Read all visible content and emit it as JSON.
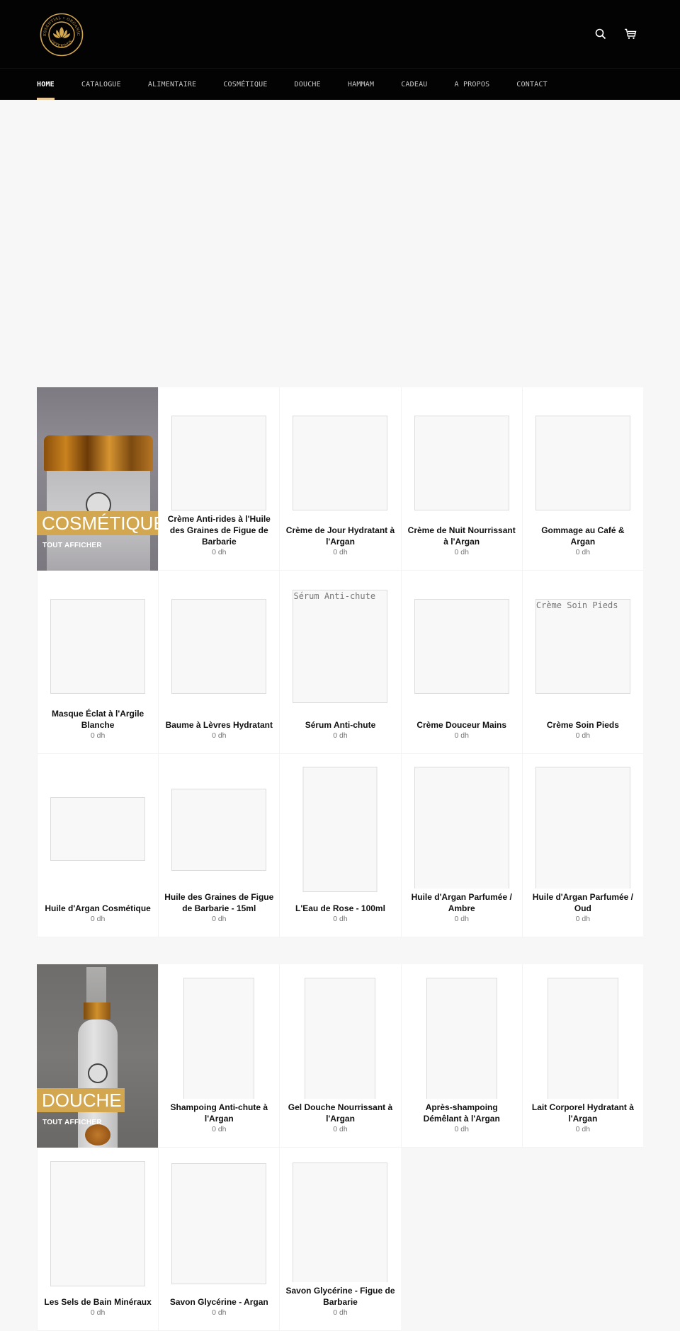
{
  "header": {
    "logo_alt": "Essential Organic Offerings",
    "logo_text_top": "ESSENTIAL • ORGANIC",
    "logo_text_bottom": "OFFERINGS",
    "search_icon": "search-icon",
    "cart_icon": "cart-icon"
  },
  "nav": {
    "items": [
      {
        "label": "HOME",
        "active": true
      },
      {
        "label": "CATALOGUE"
      },
      {
        "label": "ALIMENTAIRE"
      },
      {
        "label": "COSMÉTIQUE"
      },
      {
        "label": "DOUCHE"
      },
      {
        "label": "HAMMAM"
      },
      {
        "label": "CADEAU"
      },
      {
        "label": "A PROPOS"
      },
      {
        "label": "CONTACT"
      }
    ]
  },
  "colors": {
    "header_bg": "#030303",
    "accent_gold": "#d3a74f",
    "nav_underline": "#e8c896",
    "page_bg": "#f7f7f7"
  },
  "collections": [
    {
      "title": "COSMÉTIQUE",
      "view_all": "TOUT AFFICHER",
      "products": [
        {
          "name": "Crème Anti-rides à l'Huile des Graines de Figue de Barbarie",
          "price": "0 dh"
        },
        {
          "name": "Crème de Jour Hydratant à l'Argan",
          "price": "0 dh"
        },
        {
          "name": "Crème de Nuit Nourrissant à l'Argan",
          "price": "0 dh"
        },
        {
          "name": "Gommage au Café & Argan",
          "price": "0 dh"
        },
        {
          "name": "Masque Éclat à l'Argile Blanche",
          "price": "0 dh"
        },
        {
          "name": "Baume à Lèvres Hydratant",
          "price": "0 dh"
        },
        {
          "name": "Sérum Anti-chute",
          "price": "0 dh",
          "image_alt": "Sérum Anti-chute"
        },
        {
          "name": "Crème Douceur Mains",
          "price": "0 dh"
        },
        {
          "name": "Crème Soin Pieds",
          "price": "0 dh",
          "image_alt": "Crème Soin Pieds"
        },
        {
          "name": "Huile d'Argan Cosmétique",
          "price": "0 dh"
        },
        {
          "name": "Huile des Graines de Figue de Barbarie - 15ml",
          "price": "0 dh"
        },
        {
          "name": "L'Eau de Rose - 100ml",
          "price": "0 dh"
        },
        {
          "name": "Huile d'Argan Parfumée / Ambre",
          "price": "0 dh"
        },
        {
          "name": "Huile d'Argan Parfumée / Oud",
          "price": "0 dh"
        }
      ]
    },
    {
      "title": "DOUCHE",
      "view_all": "TOUT AFFICHER",
      "products": [
        {
          "name": "Shampoing Anti-chute à l'Argan",
          "price": "0 dh"
        },
        {
          "name": "Gel Douche Nourrissant à l'Argan",
          "price": "0 dh"
        },
        {
          "name": "Après-shampoing Démêlant à l'Argan",
          "price": "0 dh"
        },
        {
          "name": "Lait Corporel Hydratant à l'Argan",
          "price": "0 dh"
        },
        {
          "name": "Les Sels de Bain Minéraux",
          "price": "0 dh"
        },
        {
          "name": "Savon Glycérine - Argan",
          "price": "0 dh"
        },
        {
          "name": "Savon Glycérine - Figue de Barbarie",
          "price": "0 dh"
        }
      ]
    }
  ]
}
